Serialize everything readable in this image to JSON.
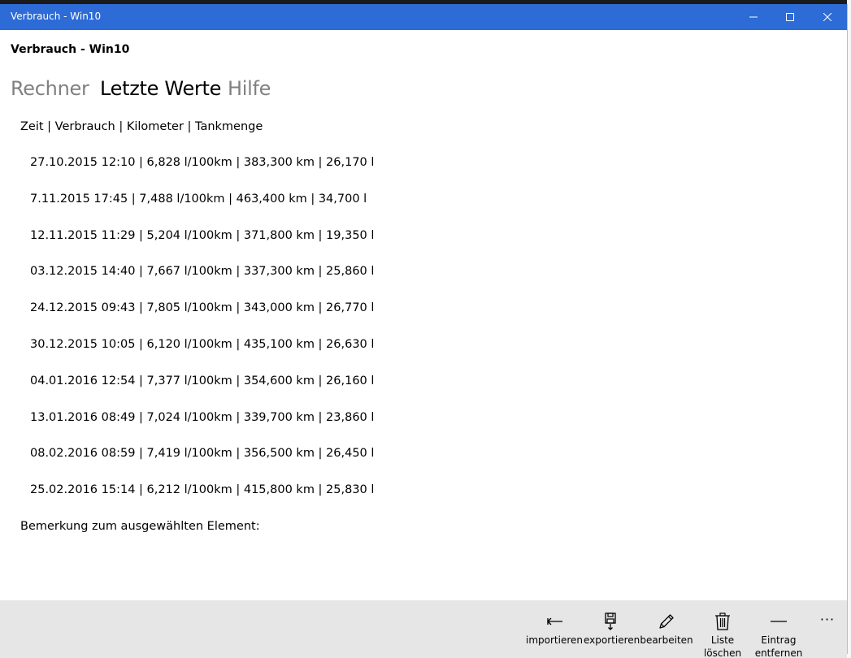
{
  "window": {
    "title": "Verbrauch - Win10",
    "buttons": {
      "minimize": "minimize-icon",
      "maximize": "maximize-icon",
      "close": "close-icon"
    }
  },
  "app": {
    "title": "Verbrauch - Win10"
  },
  "tabs": [
    {
      "label": "Rechner",
      "active": false
    },
    {
      "label": "Letzte Werte",
      "active": true
    },
    {
      "label": "Hilfe",
      "active": false
    }
  ],
  "list": {
    "header": "Zeit | Verbrauch | Kilometer | Tankmenge",
    "items": [
      "27.10.2015 12:10  |  6,828 l/100km  |  383,300 km  |  26,170 l",
      "7.11.2015 17:45  |  7,488 l/100km  |  463,400 km  |  34,700 l",
      "12.11.2015 11:29  |  5,204 l/100km  |  371,800 km  |  19,350 l",
      "03.12.2015 14:40  |  7,667 l/100km  |  337,300 km  |  25,860 l",
      "24.12.2015 09:43  |  7,805 l/100km  |  343,000 km  |  26,770 l",
      "30.12.2015 10:05  |  6,120 l/100km  |  435,100 km  |  26,630 l",
      "04.01.2016 12:54  |  7,377 l/100km  |  354,600 km  |  26,160 l",
      "13.01.2016 08:49  |  7,024 l/100km  |  339,700 km  |  23,860 l",
      "08.02.2016 08:59  |  7,419 l/100km  |  356,500 km  |  26,450 l",
      "25.02.2016 15:14  |  6,212 l/100km  |  415,800 km  |  25,830 l"
    ]
  },
  "remark_label": "Bemerkung zum ausgewählten Element:",
  "commandbar": {
    "import": "importieren",
    "export": "exportieren",
    "edit": "bearbeiten",
    "clear": "Liste löschen",
    "remove": "Eintrag\nentfernen",
    "more": "···"
  },
  "colors": {
    "titlebar": "#2d6bd6",
    "commandbar": "#e6e6e6",
    "inactive_tab": "#808080"
  }
}
